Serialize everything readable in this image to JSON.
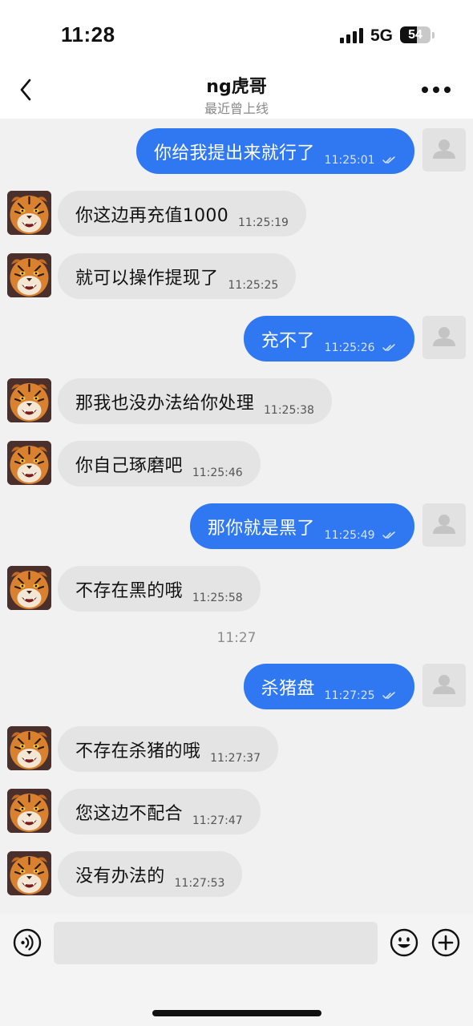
{
  "status_bar": {
    "time": "11:28",
    "network": "5G",
    "battery": "54",
    "battery_level_percent": 54
  },
  "header": {
    "title": "ng虎哥",
    "subtitle": "最近曾上线"
  },
  "colors": {
    "outgoing_bubble": "#2f78f2",
    "incoming_bubble": "#e4e4e4",
    "background": "#f1f1f1"
  },
  "icons": {
    "back": "chevron-left-icon",
    "more": "more-dots-icon",
    "voice": "voice-icon",
    "emoji": "emoji-icon",
    "plus": "plus-icon",
    "read": "double-check-icon"
  },
  "messages": [
    {
      "dir": "out",
      "text": "你给我提出来就行了",
      "time": "11:25:01",
      "read": true
    },
    {
      "dir": "in",
      "text": "你这边再充值1000",
      "time": "11:25:19"
    },
    {
      "dir": "in",
      "text": "就可以操作提现了",
      "time": "11:25:25"
    },
    {
      "dir": "out",
      "text": "充不了",
      "time": "11:25:26",
      "read": true
    },
    {
      "dir": "in",
      "text": "那我也没办法给你处理",
      "time": "11:25:38"
    },
    {
      "dir": "in",
      "text": "你自己琢磨吧",
      "time": "11:25:46"
    },
    {
      "dir": "out",
      "text": "那你就是黑了",
      "time": "11:25:49",
      "read": true
    },
    {
      "dir": "in",
      "text": "不存在黑的哦",
      "time": "11:25:58"
    },
    {
      "dir": "out",
      "text": "杀猪盘",
      "time": "11:27:25",
      "read": true
    },
    {
      "dir": "in",
      "text": "不存在杀猪的哦",
      "time": "11:27:37"
    },
    {
      "dir": "in",
      "text": "您这边不配合",
      "time": "11:27:47"
    },
    {
      "dir": "in",
      "text": "没有办法的",
      "time": "11:27:53"
    }
  ],
  "time_divider": "11:27",
  "input": {
    "value": "",
    "placeholder": ""
  }
}
